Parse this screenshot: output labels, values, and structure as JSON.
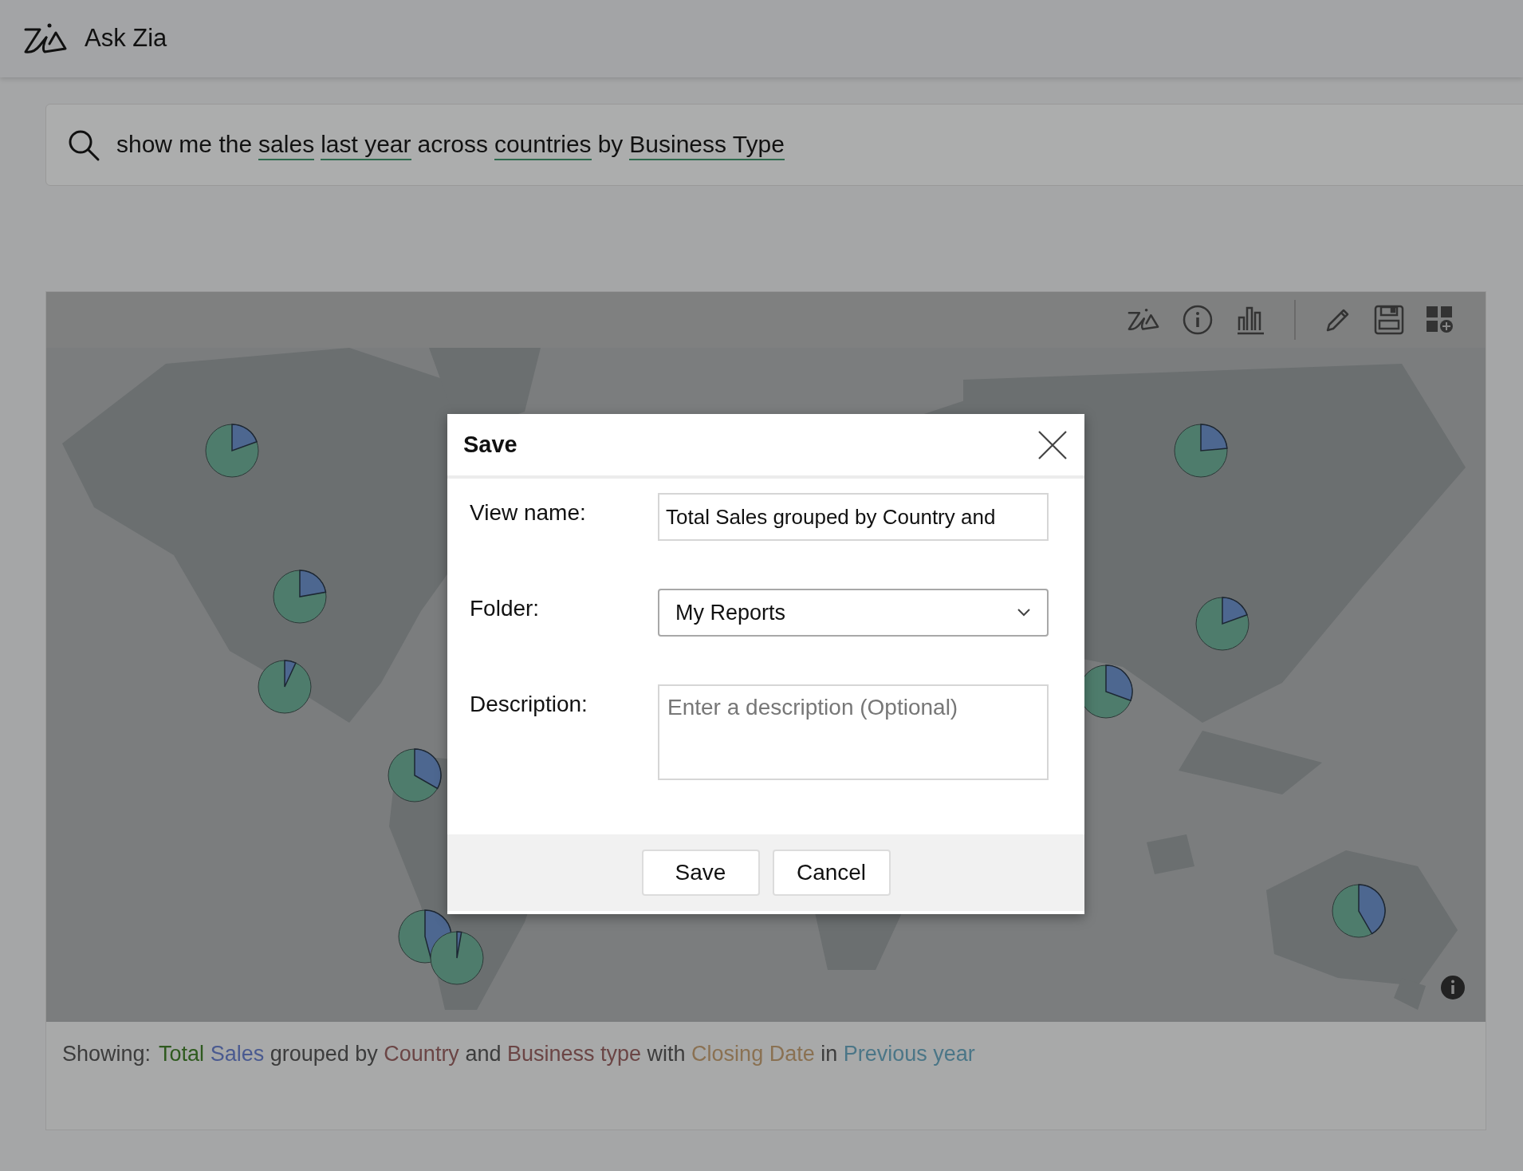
{
  "header": {
    "title": "Ask Zia"
  },
  "search": {
    "parts": [
      {
        "text": "show me the",
        "underlined": false
      },
      {
        "text": "sales",
        "underlined": true
      },
      {
        "text": "last year",
        "underlined": true
      },
      {
        "text": "across",
        "underlined": false
      },
      {
        "text": "countries",
        "underlined": true
      },
      {
        "text": "by",
        "underlined": false
      },
      {
        "text": "Business Type",
        "underlined": true
      }
    ]
  },
  "showing": {
    "label": "Showing:",
    "parts": [
      {
        "text": "Total",
        "color": "#2f5a1f"
      },
      {
        "text": "Sales",
        "color": "#4a5a90"
      },
      {
        "text": "grouped by",
        "color": "#3c3c3c"
      },
      {
        "text": "Country",
        "color": "#6b4545"
      },
      {
        "text": "and",
        "color": "#3c3c3c"
      },
      {
        "text": "Business type",
        "color": "#6b4545"
      },
      {
        "text": "with",
        "color": "#3c3c3c"
      },
      {
        "text": "Closing Date",
        "color": "#8a7152"
      },
      {
        "text": "in",
        "color": "#3c3c3c"
      },
      {
        "text": "Previous year",
        "color": "#4b7687"
      }
    ]
  },
  "dialog": {
    "title": "Save",
    "fields": [
      {
        "kind": "text",
        "label": "View name:",
        "value": "Total Sales grouped by Country and"
      },
      {
        "kind": "select",
        "label": "Folder:",
        "value": "My Reports"
      },
      {
        "kind": "textarea",
        "label": "Description:",
        "placeholder": "Enter a description (Optional)"
      }
    ],
    "buttons": [
      "Save",
      "Cancel"
    ]
  }
}
